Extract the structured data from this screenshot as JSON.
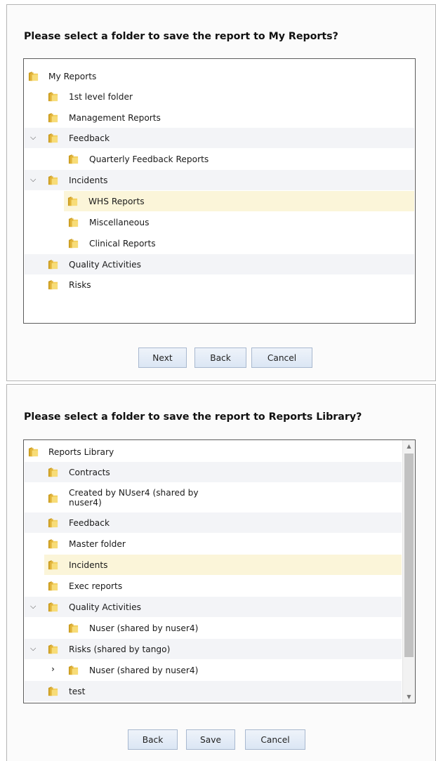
{
  "dialog1": {
    "title": "Please select a folder to save the report to My Reports?",
    "tree": [
      {
        "label": "My Reports"
      },
      {
        "label": "1st level folder"
      },
      {
        "label": "Management Reports"
      },
      {
        "label": "Feedback",
        "expanded": true
      },
      {
        "label": "Quarterly Feedback Reports"
      },
      {
        "label": "Incidents",
        "expanded": true
      },
      {
        "label": "WHS Reports",
        "selected": true
      },
      {
        "label": "Miscellaneous"
      },
      {
        "label": "Clinical Reports"
      },
      {
        "label": "Quality Activities"
      },
      {
        "label": "Risks"
      }
    ],
    "buttons": {
      "next": "Next",
      "back": "Back",
      "cancel": "Cancel"
    }
  },
  "dialog2": {
    "title": "Please select a folder to save the report to Reports Library?",
    "tree": [
      {
        "label": "Reports Library"
      },
      {
        "label": "Contracts"
      },
      {
        "label": "Created by NUser4 (shared by\nnuser4)"
      },
      {
        "label": "Feedback"
      },
      {
        "label": "Master folder"
      },
      {
        "label": "Incidents",
        "selected": true
      },
      {
        "label": "Exec reports"
      },
      {
        "label": "Quality Activities",
        "expanded": true
      },
      {
        "label": "Nuser (shared by nuser4)"
      },
      {
        "label": "Risks (shared by tango)",
        "expanded": true
      },
      {
        "label": "Nuser (shared by nuser4)",
        "collapsed": true
      },
      {
        "label": "test"
      }
    ],
    "buttons": {
      "back": "Back",
      "save": "Save",
      "cancel": "Cancel"
    }
  },
  "icons": {
    "folder": "folder-icon",
    "expand": "chevron-down-icon",
    "collapse": "chevron-right-icon",
    "scroll_up": "arrow-up-icon",
    "scroll_down": "arrow-down-icon"
  },
  "colors": {
    "selected_row": "#fbf5d9",
    "alt_row": "#f3f4f7",
    "button_bg": "#e3ebf6",
    "folder": "#e8c14a"
  }
}
